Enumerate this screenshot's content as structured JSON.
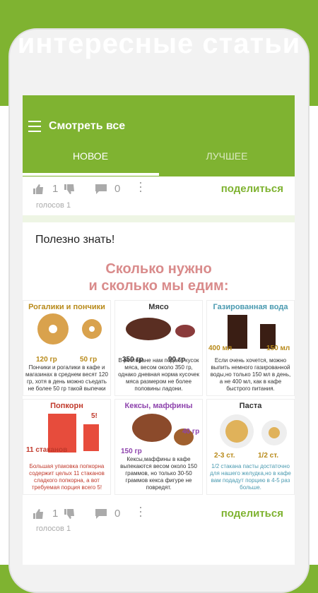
{
  "banner": {
    "text": "интересные статьи"
  },
  "app": {
    "title": "Смотреть все",
    "tabs": [
      {
        "label": "НОВОЕ"
      },
      {
        "label": "ЛУЧШЕЕ"
      }
    ]
  },
  "post_top": {
    "likes": "1",
    "comments": "0",
    "share": "поделиться",
    "votes": "голосов 1"
  },
  "post": {
    "title": "Полезно знать!",
    "infographic_title_1": "Сколько нужно",
    "infographic_title_2": "и сколько мы едим:",
    "cells": [
      {
        "title": "Рогалики и пончики",
        "a": "120 гр",
        "b": "50 гр",
        "text": "Пончики и рогалики в кафе и магазинах в среднем весят 120 гр, хотя в день можно съедать не более 50 гр такой выпечки"
      },
      {
        "title": "Мясо",
        "a": "350 гр",
        "b": "90 гр",
        "text": "В ресторане нам подают кусок мяса, весом около 350 гр, однако дневная норма кусочек мяса размером не более половины ладони."
      },
      {
        "title": "Газированная вода",
        "a": "400 мл",
        "b": "150 мл",
        "text": "Если очень хочется, можно выпить немного газированной воды,но только 150 мл в день, а не 400 мл, как в кафе быстрого питания."
      },
      {
        "title": "Попкорн",
        "a": "11 стаканов",
        "b": "5!",
        "text": "Большая упаковка попкорна содержит целых 11 стаканов сладкого попкорна, а вот требуемая порция всего 5!"
      },
      {
        "title": "Кексы, маффины",
        "a": "150 гр",
        "b": "40 гр",
        "text": "Кексы,маффины в кафе выпекаются весом около 150 граммов, но только 30-50 граммов кекса фигуре не повредят."
      },
      {
        "title": "Паста",
        "a": "2-3 ст.",
        "b": "1/2 ст.",
        "text": "1/2 стакана пасты достаточно для нашего желудка,но в кафе вам подадут порцию в 4-5 раз больше."
      }
    ]
  },
  "post_bottom": {
    "likes": "1",
    "comments": "0",
    "share": "поделиться",
    "votes": "голосов 1"
  },
  "colors": {
    "accent": "#7fb331"
  }
}
